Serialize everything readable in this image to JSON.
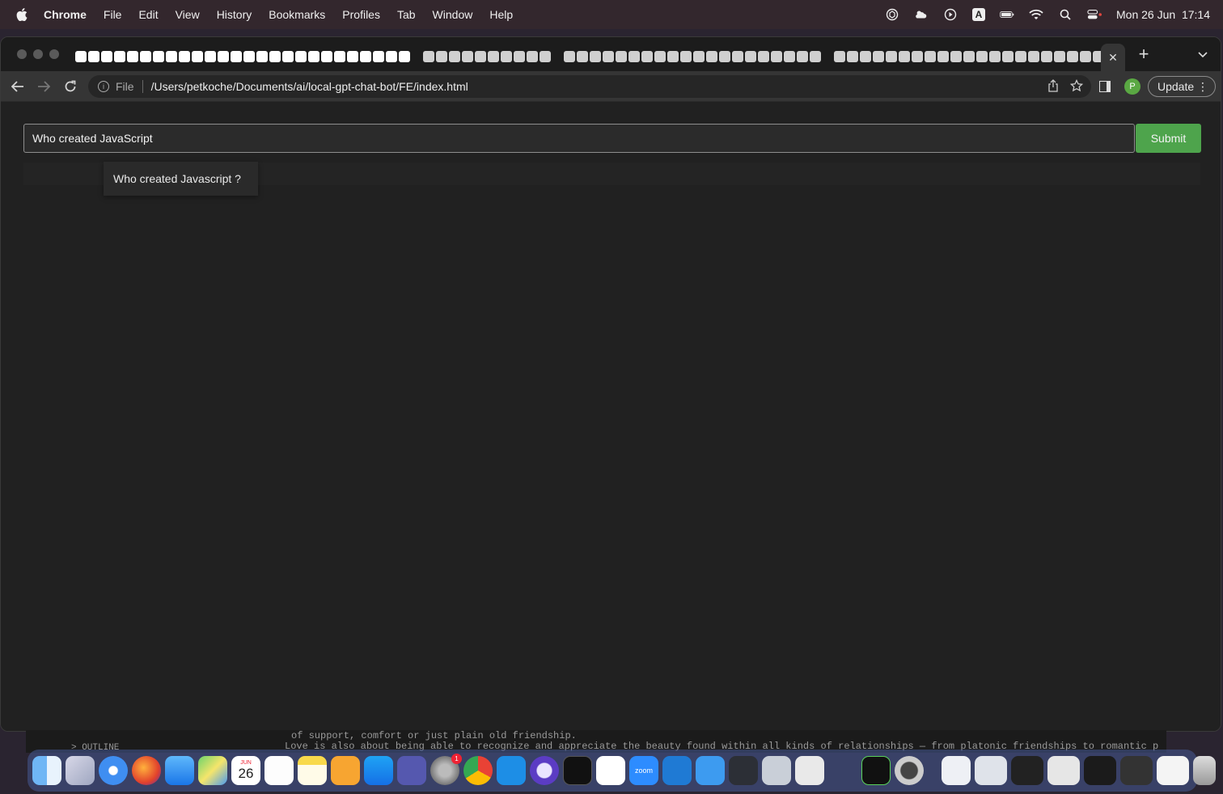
{
  "menubar": {
    "app_name": "Chrome",
    "items": [
      "File",
      "Edit",
      "View",
      "History",
      "Bookmarks",
      "Profiles",
      "Tab",
      "Window",
      "Help"
    ],
    "clock": "Mon 26 Jun  17:14",
    "input_source": "A"
  },
  "browser": {
    "address": {
      "scheme_label": "File",
      "url": "/Users/petkoche/Documents/ai/local-gpt-chat-bot/FE/index.html"
    },
    "profile_initial": "P",
    "update_label": "Update"
  },
  "page": {
    "question_value": "Who created JavaScript",
    "submit_label": "Submit",
    "suggestion_text": "Who created Javascript ?"
  },
  "background_window": {
    "line1": "of support, comfort or just plain old friendship.",
    "line2": "Love is also about being able to recognize and appreciate the beauty found within all kinds of relationships — from platonic friendships to romantic p",
    "outline_label": "> OUTLINE"
  },
  "dock": {
    "calendar_month": "JUN",
    "calendar_day": "26",
    "settings_badge": "1",
    "zoom_label": "zoom"
  },
  "colors": {
    "submit": "#4ea44c",
    "page_bg": "#212121",
    "profile": "#5aa843"
  }
}
